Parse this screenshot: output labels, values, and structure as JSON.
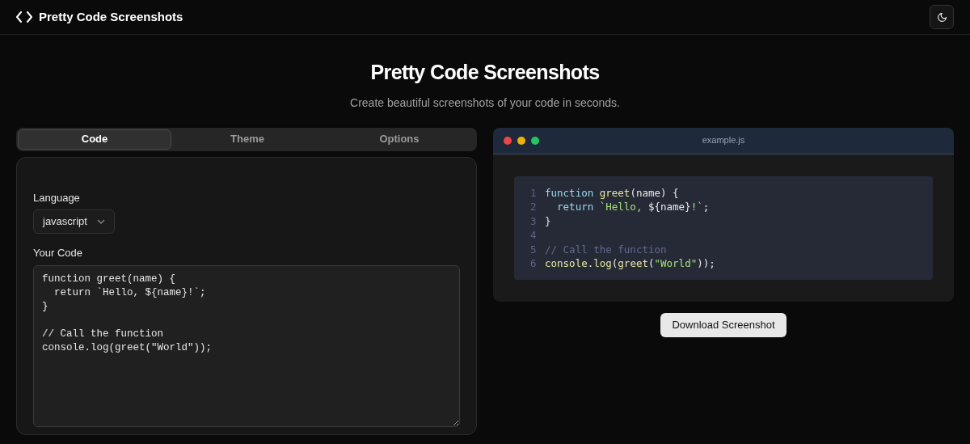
{
  "header": {
    "title": "Pretty Code Screenshots"
  },
  "hero": {
    "title": "Pretty Code Screenshots",
    "subtitle": "Create beautiful screenshots of your code in seconds."
  },
  "tabs": [
    {
      "label": "Code",
      "selected": true
    },
    {
      "label": "Theme",
      "selected": false
    },
    {
      "label": "Options",
      "selected": false
    }
  ],
  "language": {
    "label": "Language",
    "value": "javascript"
  },
  "code_input": {
    "label": "Your Code",
    "value": "function greet(name) {\n  return `Hello, ${name}!`;\n}\n\n// Call the function\nconsole.log(greet(\"World\"));"
  },
  "preview": {
    "filename": "example.js",
    "lines": [
      {
        "number": "1",
        "tokens": [
          {
            "kind": "keyword",
            "text": "function "
          },
          {
            "kind": "function",
            "text": "greet"
          },
          {
            "kind": "plain",
            "text": "(name) {"
          }
        ]
      },
      {
        "number": "2",
        "tokens": [
          {
            "kind": "keyword",
            "text": "  return "
          },
          {
            "kind": "string",
            "text": "`Hello, "
          },
          {
            "kind": "plain",
            "text": "${name}"
          },
          {
            "kind": "string",
            "text": "!`"
          },
          {
            "kind": "plain",
            "text": ";"
          }
        ]
      },
      {
        "number": "3",
        "tokens": [
          {
            "kind": "plain",
            "text": "}"
          }
        ]
      },
      {
        "number": "4"
      },
      {
        "number": "5",
        "tokens": [
          {
            "kind": "comment",
            "text": "// Call the function"
          }
        ]
      },
      {
        "number": "6",
        "tokens": [
          {
            "kind": "function",
            "text": "console"
          },
          {
            "kind": "plain",
            "text": "."
          },
          {
            "kind": "function",
            "text": "log"
          },
          {
            "kind": "plain",
            "text": "("
          },
          {
            "kind": "function",
            "text": "greet"
          },
          {
            "kind": "plain",
            "text": "("
          },
          {
            "kind": "string",
            "text": "\"World\""
          },
          {
            "kind": "plain",
            "text": "));"
          }
        ]
      }
    ]
  },
  "download_button": "Download Screenshot"
}
